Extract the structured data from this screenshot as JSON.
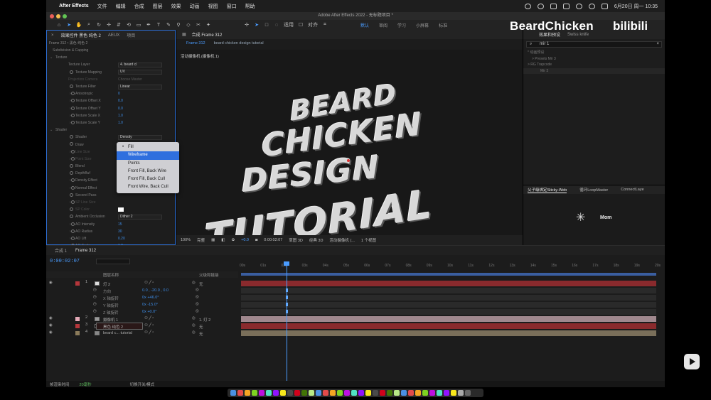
{
  "menubar": {
    "app_name": "After Effects",
    "items": [
      "文件",
      "编辑",
      "合成",
      "图层",
      "效果",
      "动画",
      "视图",
      "窗口",
      "帮助"
    ],
    "clock": "6月20日 周一 10:35"
  },
  "window": {
    "title": "Adobe After Effects 2022 - 无标题项目 *"
  },
  "toolbar": {
    "align_label": "适用",
    "snap_label": "对齐",
    "workspaces": [
      "默认",
      "审阅",
      "学习",
      "小屏幕",
      "标准"
    ]
  },
  "effect_panel": {
    "tabs": [
      "效果控件 黑色 纯色 2",
      "AEUX",
      "项目"
    ],
    "subheader": "Frame 312 • 黑色 纯色 2",
    "rows": [
      {
        "label": "Subdivision & Capping",
        "indent": 8
      },
      {
        "label": "Texture",
        "indent": 12,
        "twirl": "open"
      },
      {
        "label": "Texture Layer",
        "indent": 30,
        "dropdown": "4. beard cl"
      },
      {
        "label": "Texture Mapping",
        "indent": 40,
        "dropdown": "UV",
        "sw": true
      },
      {
        "label": "Projection Camera",
        "indent": 30,
        "value": "Choose Master",
        "dim": true
      },
      {
        "label": "Texture Filter",
        "indent": 40,
        "dropdown": "Linear",
        "sw": true
      },
      {
        "label": "Anisotropic",
        "indent": 40,
        "value": "0",
        "sw": true,
        "twirl": "closed"
      },
      {
        "label": "Texture Offset X",
        "indent": 40,
        "value": "0.0",
        "sw": true,
        "twirl": "closed"
      },
      {
        "label": "Texture Offset Y",
        "indent": 40,
        "value": "0.0",
        "sw": true,
        "twirl": "closed"
      },
      {
        "label": "Texture Scale X",
        "indent": 40,
        "value": "1.0",
        "sw": true,
        "twirl": "closed"
      },
      {
        "label": "Texture Scale Y",
        "indent": 40,
        "value": "1.0",
        "sw": true,
        "twirl": "closed"
      },
      {
        "label": "Shader",
        "indent": 12,
        "twirl": "open"
      },
      {
        "label": "Shader",
        "indent": 40,
        "dropdown": "Density",
        "sw": true
      },
      {
        "label": "Draw",
        "indent": 40,
        "dropdown": "Fill",
        "sw": true
      },
      {
        "label": "Line Size",
        "indent": 40,
        "value": "",
        "sw": true,
        "twirl": "closed",
        "dim": true
      },
      {
        "label": "Point Size",
        "indent": 40,
        "value": "",
        "sw": true,
        "twirl": "closed",
        "dim": true
      },
      {
        "label": "Blend",
        "indent": 40,
        "value": "",
        "sw": true
      },
      {
        "label": "DepthBuf",
        "indent": 40,
        "value": "",
        "sw": true
      },
      {
        "label": "Density Effect",
        "indent": 40,
        "value": "",
        "sw": true,
        "twirl": "closed"
      },
      {
        "label": "Normal Effect",
        "indent": 40,
        "value": "",
        "sw": true,
        "twirl": "closed"
      },
      {
        "label": "Second Pass",
        "indent": 40,
        "value": "",
        "sw": true
      },
      {
        "label": "SP Line Size",
        "indent": 40,
        "value": "",
        "sw": true,
        "twirl": "closed",
        "dim": true
      },
      {
        "label": "SP Color",
        "indent": 40,
        "value": "",
        "sw": true,
        "dim": true,
        "swatch": true
      },
      {
        "label": "Ambient Occlusion",
        "indent": 40,
        "dropdown": "Dither 2",
        "sw": true
      },
      {
        "label": "AO Intensity",
        "indent": 40,
        "value": "15",
        "sw": true,
        "twirl": "closed"
      },
      {
        "label": "AO Radius",
        "indent": 40,
        "value": "30",
        "sw": true,
        "twirl": "closed"
      },
      {
        "label": "AO Lift",
        "indent": 40,
        "value": "0.20",
        "sw": true,
        "twirl": "closed"
      },
      {
        "label": "AO Scale",
        "indent": 40,
        "value": "1.0",
        "sw": true,
        "twirl": "closed"
      }
    ]
  },
  "draw_menu": {
    "options": [
      "Fill",
      "Wireframe",
      "Points",
      "Front Fill, Back Wire",
      "Front Fill, Back Cull",
      "Front Wire, Back Cull"
    ],
    "checked": "Fill",
    "highlighted": "Wireframe"
  },
  "composition": {
    "tab": "合成 Frame 312",
    "breadcrumbs": [
      "Frame 312",
      "beard chicken design tutorial"
    ],
    "camera_label": "活动摄像机 (摄像机 1)",
    "art_lines": [
      "BEARD",
      "CHICKEN",
      "DESIGN",
      "TUTORIAL"
    ],
    "footer": {
      "zoom": "100%",
      "quality": "完整",
      "exposure": "+0.0",
      "timecode": "0:00:02:07",
      "renderer": "草图 3D",
      "view3d": "经典 3D",
      "camera": "活动摄像机 (...",
      "views": "1 个视图"
    }
  },
  "effects_presets": {
    "tabs": [
      "效果和预设",
      "Swiss knife"
    ],
    "search_value": "mir 1",
    "rows": [
      "* 动画预设",
      "> Presets Mir 3",
      "> RG Trapcode",
      "Mir 3"
    ]
  },
  "bottom_right": {
    "tabs": [
      "父子级绑定Sticky-Web",
      "循环LoopMaster",
      "ConnectLaye"
    ],
    "logo_text": "Mom"
  },
  "watermark": {
    "text": "BeardChicken",
    "bili": "bilibili"
  },
  "timeline": {
    "tabs": [
      "合成 1",
      "Frame 312"
    ],
    "timecode": "0:00:02:07",
    "columns": {
      "layer_name": "图层名称",
      "parent": "父级和链接"
    },
    "ruler_ticks": [
      "00s",
      "01s",
      "02s",
      "03s",
      "04s",
      "05s",
      "06s",
      "07s",
      "08s",
      "09s",
      "10s",
      "11s",
      "12s",
      "13s",
      "14s",
      "15s",
      "16s",
      "17s",
      "18s",
      "19s",
      "20s"
    ],
    "layers": [
      {
        "num": "1",
        "name": "灯 2",
        "parent": "无",
        "chip": "#b5363b",
        "icon": "#ddd"
      },
      {
        "num": "",
        "name": "方向",
        "parent": "",
        "value": "0.0 , -20.0 , 0.0",
        "sub": true
      },
      {
        "num": "",
        "name": "X 轴旋转",
        "parent": "",
        "value": "0x +46.0°",
        "sub": true
      },
      {
        "num": "",
        "name": "Y 轴旋转",
        "parent": "",
        "value": "0x -15.0°",
        "sub": true
      },
      {
        "num": "",
        "name": "Z 轴旋转",
        "parent": "",
        "value": "0x +0.0°",
        "sub": true
      },
      {
        "num": "2",
        "name": "摄像机 1",
        "parent": "1. 灯 2",
        "chip": "#e3a9b6",
        "icon": "#999"
      },
      {
        "num": "3",
        "name": "黑色 纯色 2",
        "parent": "无",
        "chip": "#b5363b",
        "icon": "#111",
        "highlight": true
      },
      {
        "num": "4",
        "name": "beard c... tutorial",
        "parent": "无",
        "chip": "#8b7b5a",
        "icon": "#888"
      }
    ],
    "footer": {
      "render_label": "帧渲染时间",
      "render_time": "20毫秒",
      "toggle_label": "切换开关/模式"
    }
  },
  "colors": {
    "accent": "#4a9cff",
    "selection": "#2f6fde",
    "layer_red": "#b5363b"
  }
}
